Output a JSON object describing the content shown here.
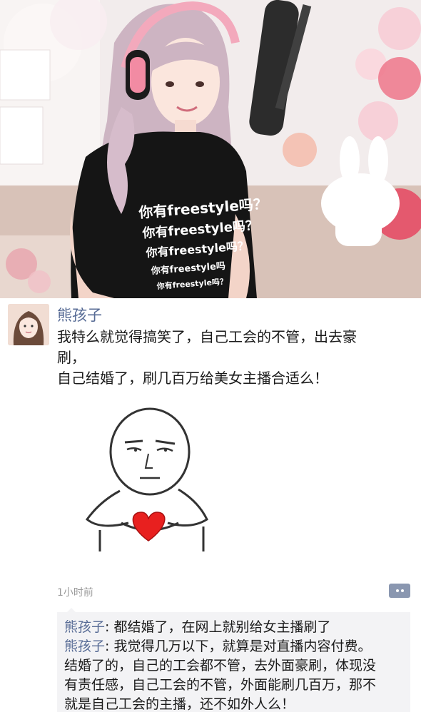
{
  "post": {
    "username": "熊孩子",
    "content_lines": [
      "我特么就觉得搞笑了，自己工会的不管，出去豪",
      "刷，",
      "自己结婚了，刷几百万给美女主播合适么！"
    ],
    "time": "1小时前"
  },
  "comments": [
    {
      "name": "熊孩子",
      "text": "都结婚了，在网上就别给女主播刷了"
    },
    {
      "name": "熊孩子",
      "text": "我觉得几万以下，就算是对直播内容付费。"
    },
    {
      "name": "",
      "text": "结婚了的，自己的工会都不管，去外面豪刷，体现没"
    },
    {
      "name": "",
      "text": "有责任感，自己工会的不管，外面能刷几百万，那不"
    },
    {
      "name": "",
      "text": "就是自己工会的主播，还不如外人么！"
    }
  ],
  "shirt_text": [
    "你有freestyle吗？",
    "你有freestyle吗？",
    "你有freestyle吗？",
    "你有freestyle吗",
    "你有freestyle吗？"
  ],
  "colors": {
    "name_link": "#576b95",
    "comment_bg": "#f3f3f5",
    "shirt": "#151515",
    "hair": "#cdb4c2"
  }
}
